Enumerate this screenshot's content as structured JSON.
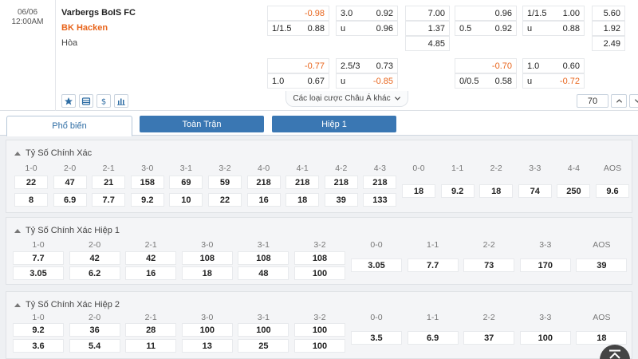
{
  "match": {
    "date": "06/06",
    "time": "12:00AM",
    "home": "Varbergs BoIS FC",
    "away": "BK Hacken",
    "draw": "Hòa"
  },
  "odds": {
    "ft_hdp": {
      "home_line": "",
      "home": "-0.98",
      "away_line": "1/1.5",
      "away": "0.88"
    },
    "ft_ou": {
      "over_line": "3.0",
      "over": "0.92",
      "under_line": "u",
      "under": "0.96"
    },
    "ft_1x2": {
      "home": "7.00",
      "away": "1.37",
      "draw": "4.85"
    },
    "h1_hdp": {
      "home_line": "",
      "home": "0.96",
      "away_line": "0.5",
      "away": "0.92"
    },
    "h1_ou": {
      "over_line": "1/1.5",
      "over": "1.00",
      "under_line": "u",
      "under": "0.88"
    },
    "h1_1x2": {
      "home": "5.60",
      "away": "1.92",
      "draw": "2.49"
    },
    "ft_hdp2": {
      "home_line": "",
      "home": "-0.77",
      "away_line": "1.0",
      "away": "0.67"
    },
    "ft_ou2": {
      "over_line": "2.5/3",
      "over": "0.73",
      "under_line": "u",
      "under": "-0.85"
    },
    "h1_hdp2": {
      "home_line": "",
      "home": "-0.70",
      "away_line": "0/0.5",
      "away": "0.58"
    },
    "h1_ou2": {
      "over_line": "1.0",
      "over": "0.60",
      "under_line": "u",
      "under": "-0.72"
    }
  },
  "toolbar": {
    "other_bets": "Các loại cược Châu Á khác",
    "count": "70"
  },
  "tabs": [
    "Phổ biến",
    "Toàn Trận",
    "Hiệp 1"
  ],
  "sections": [
    {
      "title": "Tỷ Số Chính Xác",
      "labels": [
        "1-0",
        "2-0",
        "2-1",
        "3-0",
        "3-1",
        "3-2",
        "4-0",
        "4-1",
        "4-2",
        "4-3",
        "0-0",
        "1-1",
        "2-2",
        "3-3",
        "4-4",
        "AOS"
      ],
      "top": [
        "22",
        "47",
        "21",
        "158",
        "69",
        "59",
        "218",
        "218",
        "218",
        "218"
      ],
      "bottom": [
        "8",
        "6.9",
        "7.7",
        "9.2",
        "10",
        "22",
        "16",
        "18",
        "39",
        "133"
      ],
      "mid": [
        "18",
        "9.2",
        "18",
        "74",
        "250",
        "9.6"
      ]
    },
    {
      "title": "Tỷ Số Chính Xác Hiệp 1",
      "labels": [
        "1-0",
        "2-0",
        "2-1",
        "3-0",
        "3-1",
        "3-2",
        "0-0",
        "1-1",
        "2-2",
        "3-3",
        "AOS"
      ],
      "top": [
        "7.7",
        "42",
        "42",
        "108",
        "108",
        "108"
      ],
      "bottom": [
        "3.05",
        "6.2",
        "16",
        "18",
        "48",
        "100"
      ],
      "mid": [
        "3.05",
        "7.7",
        "73",
        "170",
        "39"
      ]
    },
    {
      "title": "Tỷ Số Chính Xác Hiệp 2",
      "labels": [
        "1-0",
        "2-0",
        "2-1",
        "3-0",
        "3-1",
        "3-2",
        "0-0",
        "1-1",
        "2-2",
        "3-3",
        "AOS"
      ],
      "top": [
        "9.2",
        "36",
        "28",
        "100",
        "100",
        "100"
      ],
      "bottom": [
        "3.6",
        "5.4",
        "11",
        "13",
        "25",
        "100"
      ],
      "mid": [
        "3.5",
        "6.9",
        "37",
        "100",
        "18"
      ]
    }
  ],
  "colors": {
    "accent": "#3a77b3",
    "negative": "#e8651c",
    "home_team": "#222222",
    "away_team": "#e8651c"
  },
  "icons": [
    "star-icon",
    "bet-slip-icon",
    "dollar-icon",
    "stats-icon",
    "chevron-down-icon",
    "chevron-up-icon",
    "chevron-down-icon",
    "scroll-top-icon"
  ]
}
